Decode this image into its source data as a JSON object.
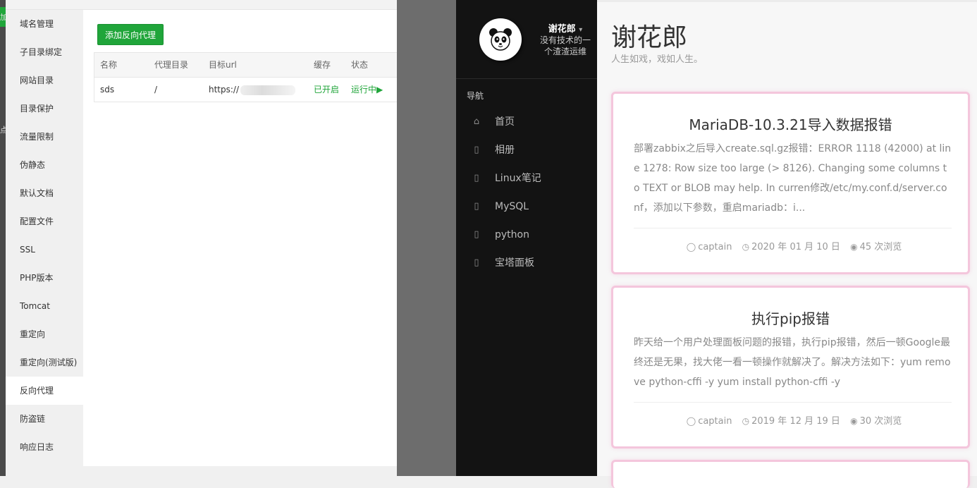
{
  "left_edge": {
    "chars": [
      "加",
      "点"
    ]
  },
  "modal": {
    "sidebar": [
      {
        "label": "域名管理"
      },
      {
        "label": "子目录绑定"
      },
      {
        "label": "网站目录"
      },
      {
        "label": "目录保护"
      },
      {
        "label": "流量限制"
      },
      {
        "label": "伪静态"
      },
      {
        "label": "默认文档"
      },
      {
        "label": "配置文件"
      },
      {
        "label": "SSL"
      },
      {
        "label": "PHP版本"
      },
      {
        "label": "Tomcat"
      },
      {
        "label": "重定向"
      },
      {
        "label": "重定向(测试版)"
      },
      {
        "label": "反向代理",
        "active": true
      },
      {
        "label": "防盗链"
      },
      {
        "label": "响应日志"
      }
    ],
    "add_button": "添加反向代理",
    "table": {
      "headers": [
        "名称",
        "代理目录",
        "目标url",
        "缓存",
        "状态"
      ],
      "rows": [
        {
          "name": "sds",
          "dir": "/",
          "url": "https://",
          "cache": "已开启",
          "status": "运行中▶"
        }
      ]
    }
  },
  "blog": {
    "author": {
      "name": "谢花郎",
      "caret": "▾",
      "desc": [
        "没有技术的一",
        "个渣渣运维"
      ]
    },
    "nav_heading": "导航",
    "nav": [
      {
        "icon": "home-icon",
        "glyph": "⌂",
        "label": "首页"
      },
      {
        "icon": "album-icon",
        "glyph": "▯",
        "label": "相册"
      },
      {
        "icon": "linux-icon",
        "glyph": "▯",
        "label": "Linux笔记"
      },
      {
        "icon": "mysql-icon",
        "glyph": "▯",
        "label": "MySQL"
      },
      {
        "icon": "python-icon",
        "glyph": "▯",
        "label": "python"
      },
      {
        "icon": "panel-icon",
        "glyph": "▯",
        "label": "宝塔面板"
      }
    ],
    "title": "谢花郎",
    "subtitle": "人生如戏，戏如人生。",
    "posts": [
      {
        "title": "MariaDB-10.3.21导入数据报错",
        "excerpt": "部署zabbix之后导入create.sql.gz报错：ERROR 1118 (42000) at line 1278: Row size too large (> 8126). Changing some columns to TEXT or BLOB may help. In curren修改/etc/my.conf.d/server.conf，添加以下参数，重启mariadb：i...",
        "author": "captain",
        "date": "2020 年 01 月 10 日",
        "views": "45 次浏览"
      },
      {
        "title": "执行pip报错",
        "excerpt": "昨天给一个用户处理面板问题的报错，执行pip报错，然后一顿Google最终还是无果，找大佬一看一顿操作就解决了。解决方法如下：yum remove python-cffi -y yum install python-cffi -y",
        "author": "captain",
        "date": "2019 年 12 月 19 日",
        "views": "30 次浏览"
      }
    ]
  }
}
